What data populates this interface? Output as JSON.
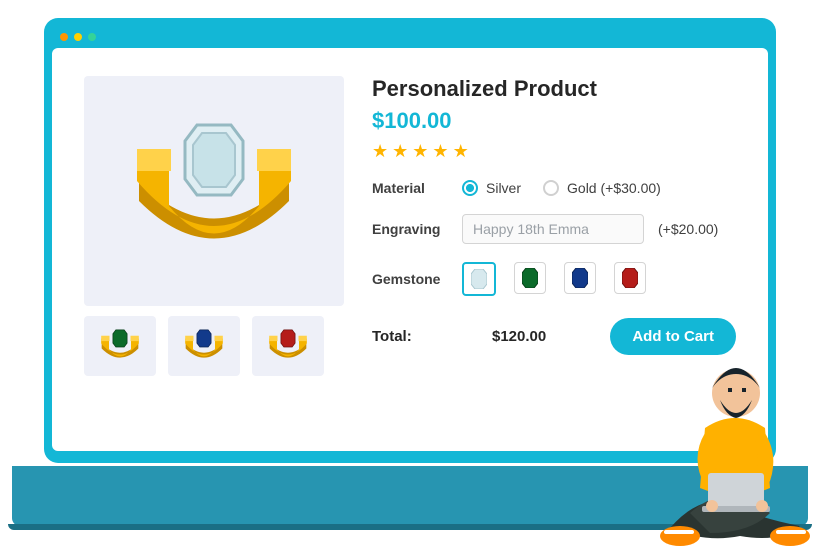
{
  "product": {
    "title": "Personalized Product",
    "price": "$100.00",
    "rating": 5,
    "options": {
      "material": {
        "label": "Material",
        "choices": [
          {
            "label": "Silver",
            "surcharge": "",
            "selected": true
          },
          {
            "label": "Gold (+$30.00)",
            "surcharge": "+$30.00",
            "selected": false
          }
        ]
      },
      "engraving": {
        "label": "Engraving",
        "value": "Happy 18th Emma",
        "surcharge": "(+$20.00)"
      },
      "gemstone": {
        "label": "Gemstone",
        "choices": [
          {
            "name": "clear",
            "color": "#d7e9ee",
            "selected": true
          },
          {
            "name": "green",
            "color": "#0b6b2a",
            "selected": false
          },
          {
            "name": "blue",
            "color": "#123a8b",
            "selected": false
          },
          {
            "name": "red",
            "color": "#b51d1a",
            "selected": false
          }
        ]
      }
    },
    "total": {
      "label": "Total:",
      "value": "$120.00"
    },
    "cta": "Add to Cart"
  },
  "thumbs": [
    {
      "gem_color": "#0b6b2a"
    },
    {
      "gem_color": "#123a8b"
    },
    {
      "gem_color": "#b51d1a"
    }
  ]
}
